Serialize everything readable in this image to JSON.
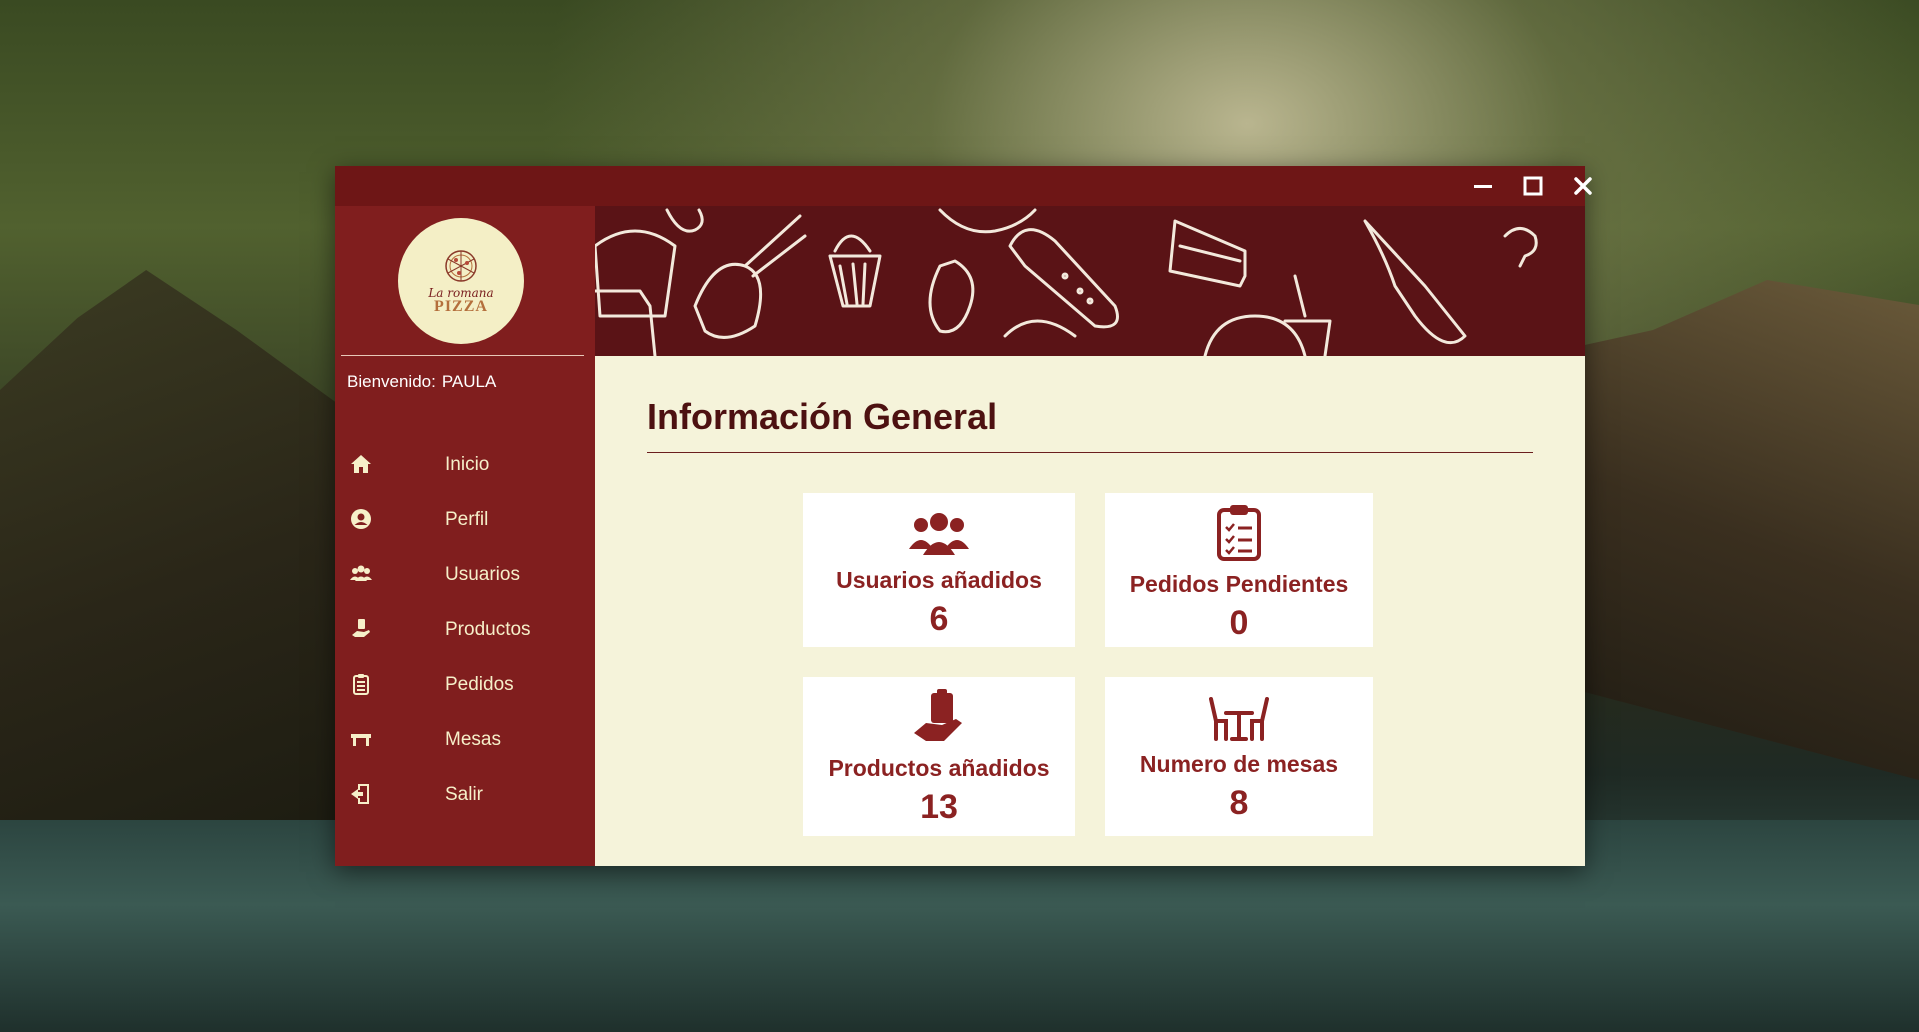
{
  "window": {
    "controls": {
      "minimize_icon": "minimize-icon",
      "maximize_icon": "maximize-icon",
      "close_icon": "close-icon"
    }
  },
  "logo": {
    "script": "La romana",
    "word": "PIZZA"
  },
  "user": {
    "welcome_label": "Bienvenido:",
    "name": "PAULA"
  },
  "sidebar": {
    "items": [
      {
        "label": "Inicio",
        "icon": "home-icon"
      },
      {
        "label": "Perfil",
        "icon": "user-circle-icon"
      },
      {
        "label": "Usuarios",
        "icon": "users-icon"
      },
      {
        "label": "Productos",
        "icon": "hand-product-icon"
      },
      {
        "label": "Pedidos",
        "icon": "clipboard-list-icon"
      },
      {
        "label": "Mesas",
        "icon": "table-icon"
      },
      {
        "label": "Salir",
        "icon": "exit-door-icon"
      }
    ]
  },
  "main": {
    "title": "Información General",
    "cards": [
      {
        "label": "Usuarios añadidos",
        "value": "6",
        "icon": "users-icon"
      },
      {
        "label": "Pedidos Pendientes",
        "value": "0",
        "icon": "clipboard-check-icon"
      },
      {
        "label": "Productos añadidos",
        "value": "13",
        "icon": "hand-holding-box-icon"
      },
      {
        "label": "Numero de mesas",
        "value": "8",
        "icon": "table-chairs-icon"
      }
    ]
  },
  "colors": {
    "sidebar": "#801e1e",
    "titlebar": "#6e1616",
    "content_bg": "#f5f3da",
    "accent_text": "#8b2222",
    "nav_text": "#f6efc9",
    "logo_bg": "#f4efc6"
  }
}
